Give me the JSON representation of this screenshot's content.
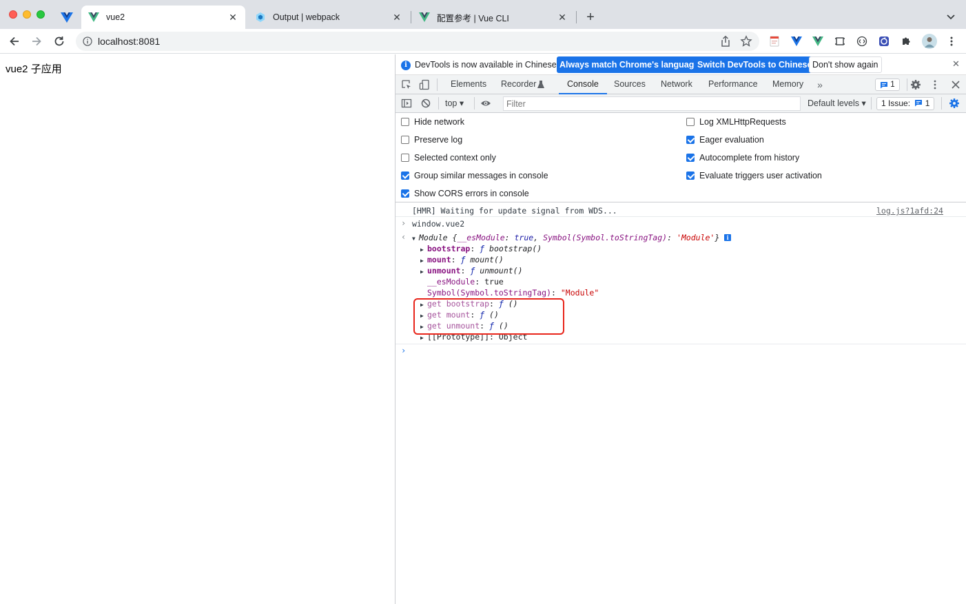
{
  "browser": {
    "tabs": [
      {
        "title": "vue2",
        "active": true,
        "icon": "vue-logo-icon"
      },
      {
        "title": "Output | webpack",
        "active": false,
        "icon": "webpack-icon"
      },
      {
        "title": "配置参考 | Vue CLI",
        "active": false,
        "icon": "vue-logo-icon"
      }
    ],
    "url": "localhost:8081"
  },
  "page": {
    "heading": "vue2 子应用"
  },
  "devtools": {
    "infobar": {
      "text": "DevTools is now available in Chinese!",
      "btn_match": "Always match Chrome's language",
      "btn_switch": "Switch DevTools to Chinese",
      "btn_dismiss": "Don't show again"
    },
    "tabs": [
      "Elements",
      "Recorder",
      "Console",
      "Sources",
      "Network",
      "Performance",
      "Memory"
    ],
    "active_tab": "Console",
    "message_count": "1",
    "toolbar": {
      "context": "top",
      "filter_placeholder": "Filter",
      "levels": "Default levels",
      "issues_label": "1 Issue:",
      "issues_count": "1"
    },
    "settings": {
      "left": [
        {
          "label": "Hide network",
          "checked": false
        },
        {
          "label": "Preserve log",
          "checked": false
        },
        {
          "label": "Selected context only",
          "checked": false
        },
        {
          "label": "Group similar messages in console",
          "checked": true
        },
        {
          "label": "Show CORS errors in console",
          "checked": true
        }
      ],
      "right": [
        {
          "label": "Log XMLHttpRequests",
          "checked": false
        },
        {
          "label": "Eager evaluation",
          "checked": true
        },
        {
          "label": "Autocomplete from history",
          "checked": true
        },
        {
          "label": "Evaluate triggers user activation",
          "checked": true
        }
      ]
    },
    "console": {
      "hmr_message": "[HMR] Waiting for update signal from WDS...",
      "hmr_source": "log.js?1afd:24",
      "command": "window.vue2",
      "result_summary": {
        "prefix": "Module {",
        "key1": "__esModule",
        "val1": "true",
        "key2": "Symbol(Symbol.toStringTag)",
        "val2": "'Module'",
        "suffix": "}"
      },
      "props": [
        {
          "key": "bootstrap",
          "f": "ƒ",
          "sig": "bootstrap()"
        },
        {
          "key": "mount",
          "f": "ƒ",
          "sig": "mount()"
        },
        {
          "key": "unmount",
          "f": "ƒ",
          "sig": "unmount()"
        }
      ],
      "esmodule_key": "__esModule",
      "esmodule_val": "true",
      "symbol_key": "Symbol(Symbol.toStringTag)",
      "symbol_val": "\"Module\"",
      "getters": [
        {
          "key": "get bootstrap",
          "f": "ƒ",
          "sig": "()"
        },
        {
          "key": "get mount",
          "f": "ƒ",
          "sig": "()"
        },
        {
          "key": "get unmount",
          "f": "ƒ",
          "sig": "()"
        }
      ],
      "prototype_key": "[[Prototype]]",
      "prototype_val": "Object"
    }
  },
  "colors": {
    "accent": "#1a73e8",
    "highlight_box": "#e8241a",
    "vue_green": "#41b883",
    "vue_dark": "#35495e"
  }
}
